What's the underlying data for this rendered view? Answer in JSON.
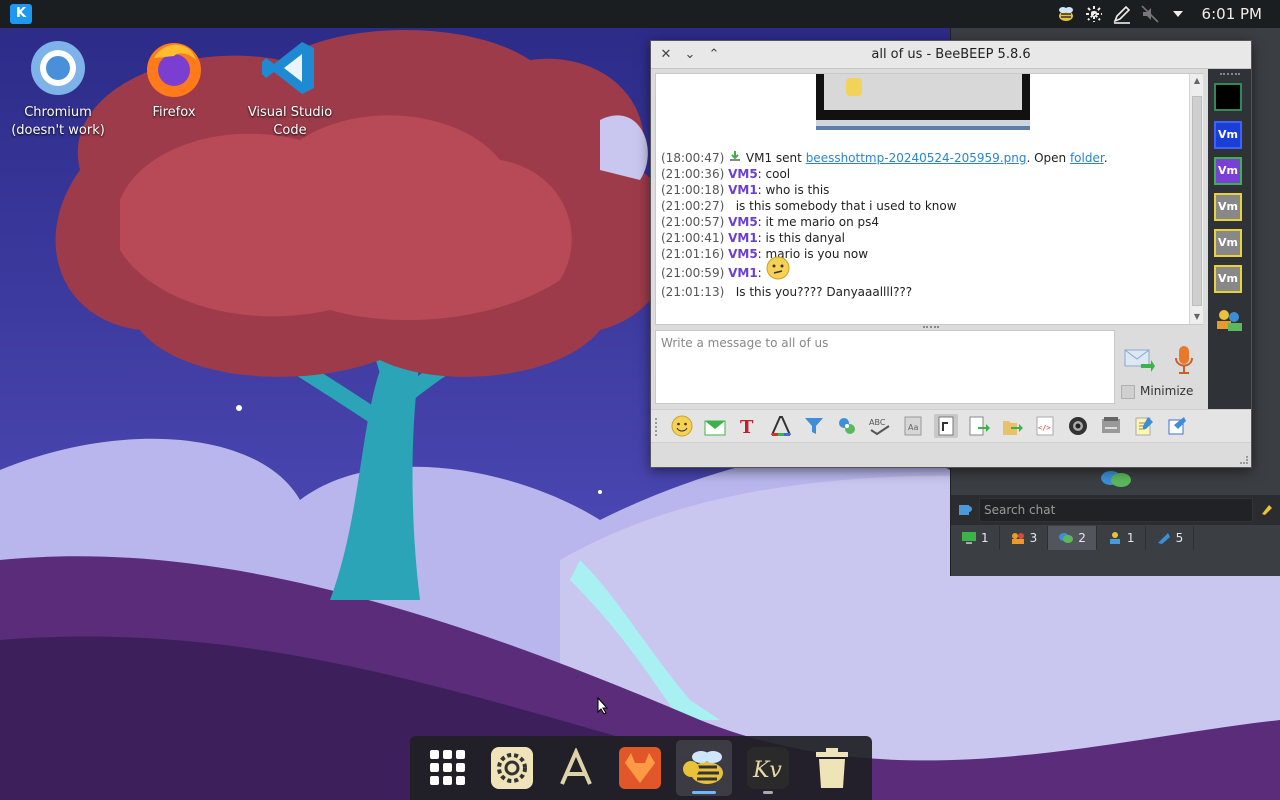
{
  "top_panel": {
    "launcher": "K",
    "clock": "6:01 PM",
    "tray_icons": [
      "beebeep-icon",
      "network-icon",
      "pen-icon",
      "volume-muted-icon",
      "chevron-down-icon"
    ]
  },
  "desktop": {
    "icons": [
      {
        "label": "Chromium\n(doesn't work)",
        "icon": "chromium-icon"
      },
      {
        "label": "Firefox",
        "icon": "firefox-icon"
      },
      {
        "label": "Visual Studio\nCode",
        "icon": "vscode-icon"
      }
    ]
  },
  "main_window": {
    "search_placeholder": "Search chat",
    "tabs": [
      {
        "icon": "computer-icon",
        "count": "1"
      },
      {
        "icon": "group-icon",
        "count": "3"
      },
      {
        "icon": "chat-icon",
        "count": "2"
      },
      {
        "icon": "users-icon",
        "count": "1"
      },
      {
        "icon": "share-icon",
        "count": "5"
      }
    ]
  },
  "chat_window": {
    "title": "all of us - BeeBEEP 5.8.6",
    "messages": [
      {
        "time": "(18:00:47)",
        "prefix": " VM1 sent ",
        "link": "beesshottmp-20240524-205959.png",
        "mid": ". Open ",
        "link2": "folder",
        "suffix": "."
      },
      {
        "time": "(21:00:36)",
        "user": "VM5",
        "text": ": cool"
      },
      {
        "time": "(21:00:18)",
        "user": "VM1",
        "text": ": who is this"
      },
      {
        "time": "(21:00:27)",
        "user": "",
        "text": "   is this somebody that i used to know"
      },
      {
        "time": "(21:00:57)",
        "user": "VM5",
        "text": ": it me mario on ps4"
      },
      {
        "time": "(21:00:41)",
        "user": "VM1",
        "text": ": is this danyal"
      },
      {
        "time": "(21:01:16)",
        "user": "VM5",
        "text": ": mario is you now"
      },
      {
        "time": "(21:00:59)",
        "user": "VM1",
        "text": ": "
      },
      {
        "time": "(21:01:13)",
        "user": "",
        "text": "   Is this you???? Danyaaallll???"
      }
    ],
    "input_placeholder": "Write a message to all of us",
    "minimize_label": "Minimize",
    "toolbar_icons": [
      "smiley-icon",
      "mail-icon",
      "font-icon",
      "color-icon",
      "filter-icon",
      "puzzle-icon",
      "spellcheck-icon",
      "font-size-icon",
      "paste-icon",
      "send-file-icon",
      "send-folder-icon",
      "html-icon",
      "screenshot-icon",
      "print-icon",
      "notes-icon",
      "share-icon"
    ],
    "side_badges": [
      "Vm",
      "Vm",
      "Vm",
      "Vm",
      "Vm"
    ],
    "accent": "#6b3fd6",
    "link_color": "#2a84d2"
  },
  "dock": {
    "items": [
      "app-grid-icon",
      "settings-icon",
      "text-editor-icon",
      "gitlab-icon",
      "beebeep-icon",
      "kvantum-icon",
      "trash-icon"
    ]
  }
}
